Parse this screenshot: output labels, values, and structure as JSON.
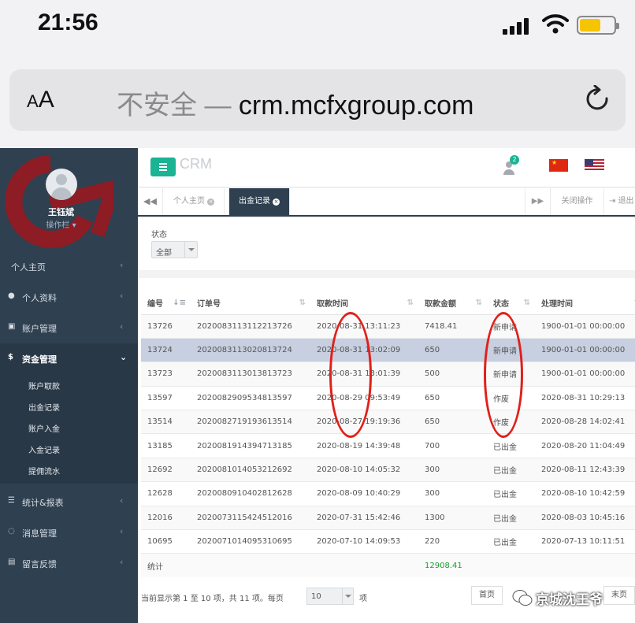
{
  "status_bar": {
    "time": "21:56"
  },
  "browser": {
    "aa_small": "A",
    "aa_large": "A",
    "insecure_label": "不安全 — ",
    "url": "crm.mcfxgroup.com"
  },
  "sidebar": {
    "user_name": "王钰斌",
    "user_role": "操作栏 ▾",
    "items": [
      {
        "label": "个人主页"
      },
      {
        "label": "个人资料"
      },
      {
        "label": "账户管理"
      },
      {
        "label": "资金管理"
      },
      {
        "label": "统计&报表"
      },
      {
        "label": "消息管理"
      },
      {
        "label": "留言反馈"
      }
    ],
    "sub_items": [
      {
        "label": "账户取款"
      },
      {
        "label": "出金记录"
      },
      {
        "label": "账户入金"
      },
      {
        "label": "入金记录"
      },
      {
        "label": "提佣流水"
      }
    ]
  },
  "header": {
    "app_name": "CRM",
    "notification_count": "2"
  },
  "tabs": {
    "items": [
      {
        "label": "个人主页"
      },
      {
        "label": "出金记录"
      }
    ],
    "close_ops": "关闭操作",
    "logout": "退出"
  },
  "filter": {
    "label": "状态",
    "value": "全部"
  },
  "table": {
    "headers": [
      "编号",
      "订单号",
      "取款时间",
      "取款金额",
      "状态",
      "处理时间"
    ],
    "rows": [
      [
        "13726",
        "2020083113112213726",
        "2020-08-31 13:11:23",
        "7418.41",
        "新申请",
        "1900-01-01 00:00:00"
      ],
      [
        "13724",
        "2020083113020813724",
        "2020-08-31 13:02:09",
        "650",
        "新申请",
        "1900-01-01 00:00:00"
      ],
      [
        "13723",
        "2020083113013813723",
        "2020-08-31 13:01:39",
        "500",
        "新申请",
        "1900-01-01 00:00:00"
      ],
      [
        "13597",
        "2020082909534813597",
        "2020-08-29 09:53:49",
        "650",
        "作废",
        "2020-08-31 10:29:13"
      ],
      [
        "13514",
        "2020082719193613514",
        "2020-08-27 19:19:36",
        "650",
        "作废",
        "2020-08-28 14:02:41"
      ],
      [
        "13185",
        "2020081914394713185",
        "2020-08-19 14:39:48",
        "700",
        "已出金",
        "2020-08-20 11:04:49"
      ],
      [
        "12692",
        "2020081014053212692",
        "2020-08-10 14:05:32",
        "300",
        "已出金",
        "2020-08-11 12:43:39"
      ],
      [
        "12628",
        "2020080910402812628",
        "2020-08-09 10:40:29",
        "300",
        "已出金",
        "2020-08-10 10:42:59"
      ],
      [
        "12016",
        "2020073115424512016",
        "2020-07-31 15:42:46",
        "1300",
        "已出金",
        "2020-08-03 10:45:16"
      ],
      [
        "10695",
        "2020071014095310695",
        "2020-07-10 14:09:53",
        "220",
        "已出金",
        "2020-07-13 10:11:51"
      ]
    ],
    "summary_label": "统计",
    "summary_total": "12908.41"
  },
  "pagination": {
    "info": "当前显示第 1 至 10 项，共 11 项。每页",
    "page_size": "10",
    "suffix": "项",
    "first": "首页",
    "last": "末页"
  },
  "watermark": {
    "text": "京城沈王爷"
  },
  "colors": {
    "sidebar_bg": "#2f4050",
    "accent_green": "#1ab394",
    "annotation_red": "#e0201a",
    "highlight_row": "#c7cfe0"
  }
}
